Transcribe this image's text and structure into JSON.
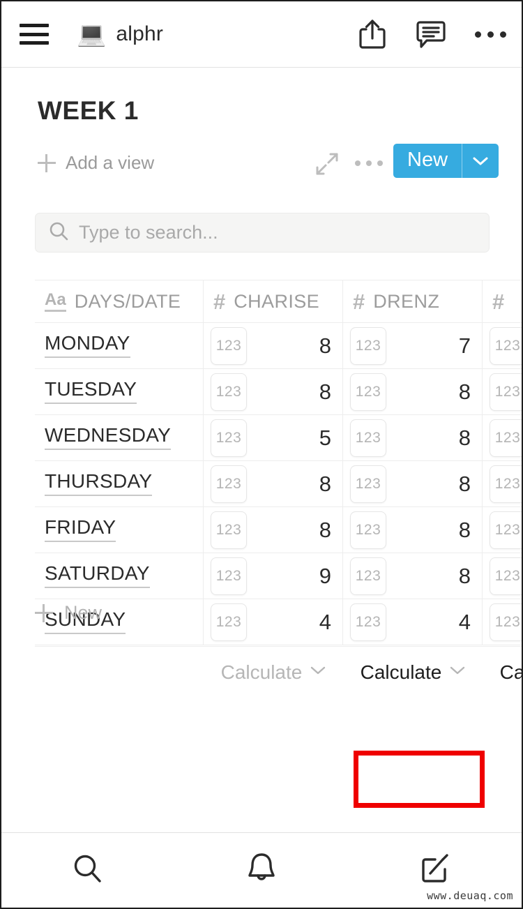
{
  "topbar": {
    "menu_icon": "hamburger-menu-icon",
    "app_emoji": "💻",
    "app_title": "alphr",
    "share_icon": "share-icon",
    "comment_icon": "comment-icon",
    "more_icon": "ellipsis-icon"
  },
  "header": {
    "page_title": "WEEK 1",
    "add_view_label": "Add a view",
    "expand_icon": "expand-arrows-icon",
    "view_more_icon": "ellipsis-icon",
    "new_button_label": "New",
    "new_button_caret": "chevron-down-icon",
    "new_button_color": "#36abe0"
  },
  "search": {
    "icon": "search-icon",
    "placeholder": "Type to search...",
    "value": ""
  },
  "table": {
    "columns": [
      {
        "label": "DAYS/DATE",
        "type_icon": "Aa",
        "type": "text"
      },
      {
        "label": "CHARISE",
        "type_icon": "#",
        "type": "number"
      },
      {
        "label": "DRENZ",
        "type_icon": "#",
        "type": "number"
      },
      {
        "label": "",
        "type_icon": "#",
        "type": "number"
      }
    ],
    "badge_label": "123",
    "rows": [
      {
        "day": "MONDAY",
        "charise": "8",
        "drenz": "7",
        "col4": ""
      },
      {
        "day": "TUESDAY",
        "charise": "8",
        "drenz": "8",
        "col4": ""
      },
      {
        "day": "WEDNESDAY",
        "charise": "5",
        "drenz": "8",
        "col4": ""
      },
      {
        "day": "THURSDAY",
        "charise": "8",
        "drenz": "8",
        "col4": ""
      },
      {
        "day": "FRIDAY",
        "charise": "8",
        "drenz": "8",
        "col4": ""
      },
      {
        "day": "SATURDAY",
        "charise": "9",
        "drenz": "8",
        "col4": ""
      },
      {
        "day": "SUNDAY",
        "charise": "4",
        "drenz": "4",
        "col4": ""
      }
    ],
    "new_row_label": "New",
    "footer": {
      "calc_1": "Calculate",
      "calc_2": "Calculate",
      "calc_3": "Calculate",
      "calc_4": "Ca",
      "caret_icon": "chevron-down-icon",
      "highlight_color": "#ef0000"
    }
  },
  "bottom_nav": {
    "items": [
      {
        "icon": "search-icon"
      },
      {
        "icon": "bell-icon"
      },
      {
        "icon": "compose-icon"
      }
    ]
  },
  "watermark": "www.deuaq.com"
}
